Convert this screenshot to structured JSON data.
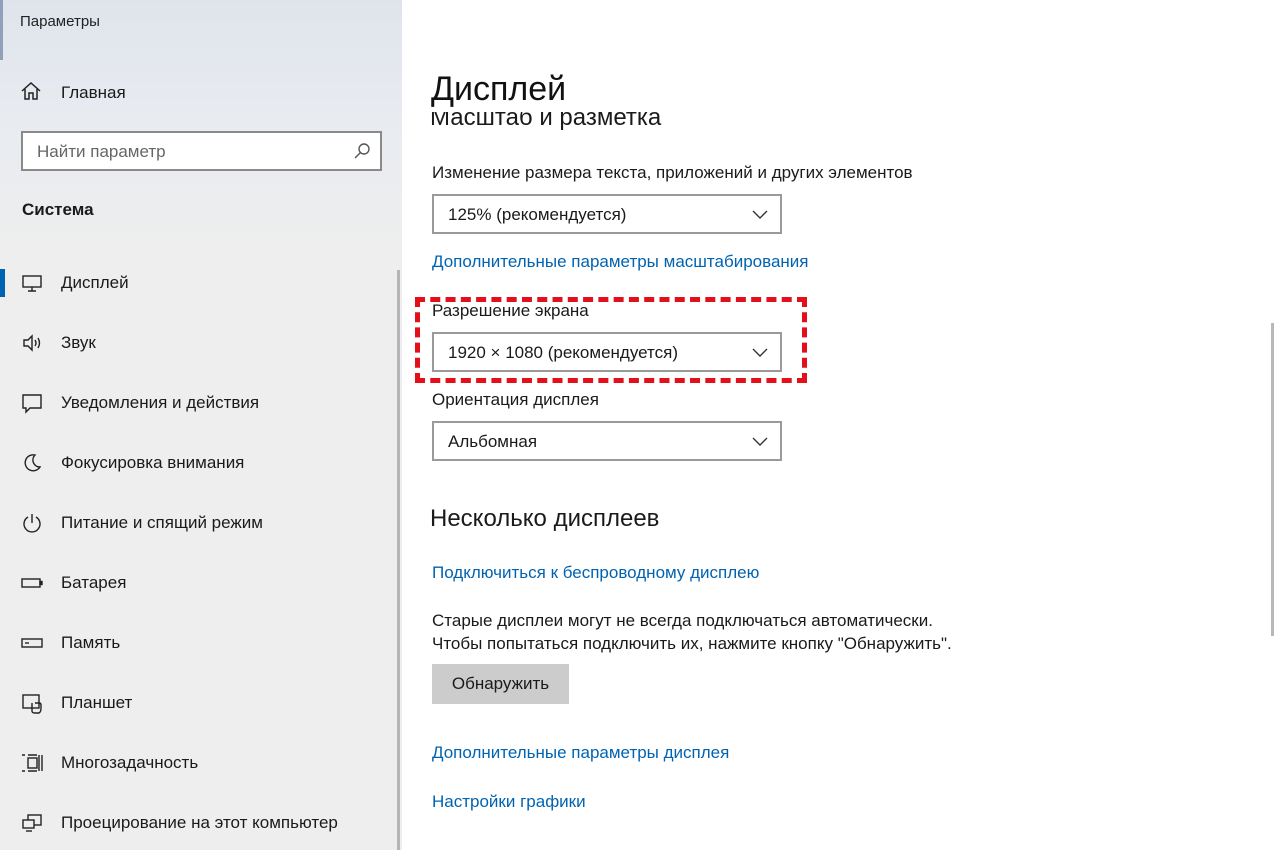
{
  "window": {
    "title": "Параметры"
  },
  "sidebar": {
    "home_label": "Главная",
    "search_placeholder": "Найти параметр",
    "section_title": "Система",
    "items": [
      {
        "label": "Дисплей",
        "icon": "monitor-icon",
        "active": true
      },
      {
        "label": "Звук",
        "icon": "speaker-icon"
      },
      {
        "label": "Уведомления и действия",
        "icon": "notification-icon"
      },
      {
        "label": "Фокусировка внимания",
        "icon": "moon-icon"
      },
      {
        "label": "Питание и спящий режим",
        "icon": "power-icon"
      },
      {
        "label": "Батарея",
        "icon": "battery-icon"
      },
      {
        "label": "Память",
        "icon": "storage-icon"
      },
      {
        "label": "Планшет",
        "icon": "tablet-icon"
      },
      {
        "label": "Многозадачность",
        "icon": "multitasking-icon"
      },
      {
        "label": "Проецирование на этот компьютер",
        "icon": "projecting-icon"
      }
    ]
  },
  "main": {
    "page_title": "Дисплей",
    "scale_heading": "Масштаб и разметка",
    "scale_label": "Изменение размера текста, приложений и других элементов",
    "scale_value": "125% (рекомендуется)",
    "advanced_scaling_link": "Дополнительные параметры масштабирования",
    "resolution_label": "Разрешение экрана",
    "resolution_value": "1920 × 1080 (рекомендуется)",
    "orientation_label": "Ориентация дисплея",
    "orientation_value": "Альбомная",
    "multiple_heading": "Несколько дисплеев",
    "wireless_link": "Подключиться к беспроводному дисплею",
    "detect_info_line1": "Старые дисплеи могут не всегда подключаться автоматически.",
    "detect_info_line2": "Чтобы попытаться подключить их, нажмите кнопку \"Обнаружить\".",
    "detect_button": "Обнаружить",
    "advanced_display_link": "Дополнительные параметры дисплея",
    "graphics_link": "Настройки графики"
  },
  "colors": {
    "accent": "#0063b1",
    "highlight": "#e3101c",
    "sidebar_bg": "#eeeeee"
  }
}
